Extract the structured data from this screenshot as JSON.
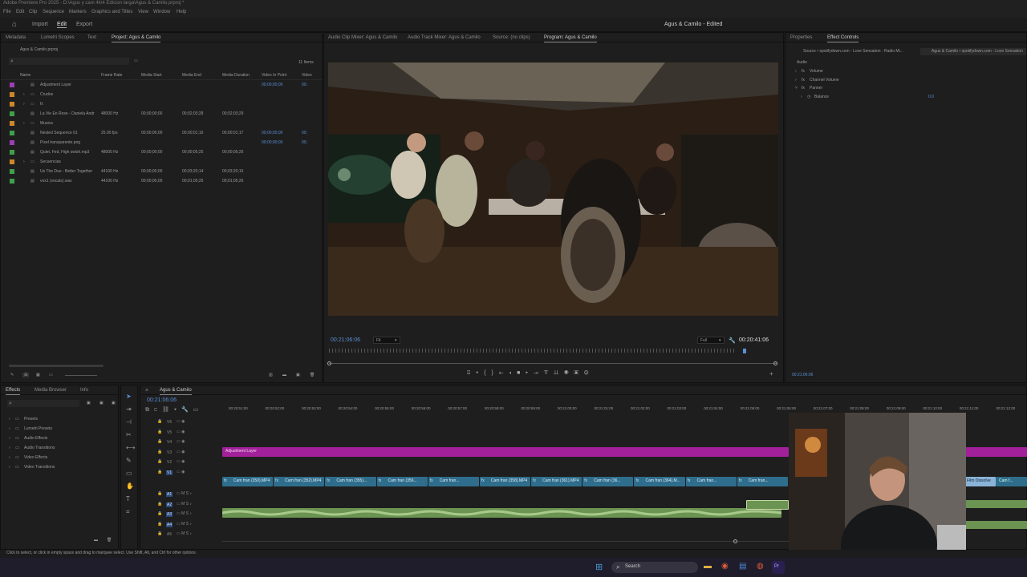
{
  "title_bar": {
    "text": "Adobe Premiere Pro 2025 - D:\\Agus y cam 4k\\4 Edicion larga\\Agus & Camilo.prproj *"
  },
  "menu": [
    "File",
    "Edit",
    "Clip",
    "Sequence",
    "Markers",
    "Graphics and Titles",
    "View",
    "Window",
    "Help"
  ],
  "workspace": {
    "tabs": [
      "Import",
      "Edit",
      "Export"
    ],
    "active": "Edit",
    "project_name": "Agus & Camilo - Edited"
  },
  "project_panel": {
    "tabs": [
      "Metadata",
      "Lumetri Scopes",
      "Text",
      "Project: Agus & Camilo"
    ],
    "active_tab": "Project: Agus & Camilo",
    "file": "Agus & Camilo.prproj",
    "item_count": "11 Items",
    "columns": [
      "Name",
      "Frame Rate",
      "Media Start",
      "Media End",
      "Media Duration",
      "Video In Point",
      "Video"
    ],
    "rows": [
      {
        "name": "Adjustment Layer",
        "fr": "",
        "ms": "",
        "me": "",
        "md": "",
        "vin": "00;00;00;00",
        "v": "00;",
        "color": "#9c3fb6",
        "folder": false
      },
      {
        "name": "Crudos",
        "fr": "",
        "ms": "",
        "me": "",
        "md": "",
        "vin": "",
        "v": "",
        "color": "#d0872a",
        "folder": true
      },
      {
        "name": "fx",
        "fr": "",
        "ms": "",
        "me": "",
        "md": "",
        "vin": "",
        "v": "",
        "color": "#d0872a",
        "folder": true
      },
      {
        "name": "La Vie En Rose - Daniela Andr",
        "fr": "48000 Hz",
        "ms": "00;00;00;00",
        "me": "00;02;03;28",
        "md": "00;02;03;29",
        "vin": "",
        "v": "",
        "color": "#3fa04a",
        "folder": false
      },
      {
        "name": "Musica",
        "fr": "",
        "ms": "",
        "me": "",
        "md": "",
        "vin": "",
        "v": "",
        "color": "#d0872a",
        "folder": true
      },
      {
        "name": "Nested Sequence 01",
        "fr": "25.00 fps",
        "ms": "00;00;00;00",
        "me": "00;00;01;16",
        "md": "00;00;01;17",
        "vin": "00;00;00;00",
        "v": "00;",
        "color": "#3fa04a",
        "folder": false
      },
      {
        "name": "Pixel transparente.png",
        "fr": "",
        "ms": "",
        "me": "",
        "md": "",
        "vin": "00;00;00;00",
        "v": "00;",
        "color": "#9c3fb6",
        "folder": false
      },
      {
        "name": "Quiet, Fed, High swish.mp3",
        "fr": "48000 Hz",
        "ms": "00;00;00;00",
        "me": "00;00;05;25",
        "md": "00;00;05;26",
        "vin": "",
        "v": "",
        "color": "#3fa04a",
        "folder": false
      },
      {
        "name": "Secuencias",
        "fr": "",
        "ms": "",
        "me": "",
        "md": "",
        "vin": "",
        "v": "",
        "color": "#d0872a",
        "folder": true
      },
      {
        "name": "Us The Duo - Better Together",
        "fr": "44100 Hz",
        "ms": "00;00;00;00",
        "me": "00;03;20;14",
        "md": "00;03;20;15",
        "vin": "",
        "v": "",
        "color": "#3fa04a",
        "folder": false
      },
      {
        "name": "vox1 (vocals).wav",
        "fr": "44100 Hz",
        "ms": "00;00;00;00",
        "me": "00;01;05;25",
        "md": "00;01;05;26",
        "vin": "",
        "v": "",
        "color": "#3fa04a",
        "folder": false
      }
    ]
  },
  "program_panel": {
    "tabs": [
      "Audio Clip Mixer: Agus & Camilo",
      "Audio Track Mixer: Agus & Camilo",
      "Source: (no clips)",
      "Program: Agus & Camilo"
    ],
    "active_tab": "Program: Agus & Camilo",
    "timecode": "00:21:06:06",
    "fit": "Fit",
    "quality": "Full",
    "duration": "00:20:41:06"
  },
  "effect_controls": {
    "tabs": [
      "Properties",
      "Effect Controls"
    ],
    "active_tab": "Effect Controls",
    "source": "Source • spotifydown.com - Love Sensation - Radio Mi...",
    "target": "Agus & Camilo • spotifydown.com - Love Sensation",
    "section": "Audio",
    "items": [
      "Volume",
      "Channel Volume",
      "Panner",
      "Balance"
    ],
    "balance_value": "0.0",
    "timecode": "00:21:06:06"
  },
  "effects_panel": {
    "tabs": [
      "Effects",
      "Media Browser",
      "Info"
    ],
    "active_tab": "Effects",
    "items": [
      "Presets",
      "Lumetri Presets",
      "Audio Effects",
      "Audio Transitions",
      "Video Effects",
      "Video Transitions"
    ]
  },
  "timeline": {
    "sequence": "Agus & Camilo",
    "timecode": "00:21:06:06",
    "ruler": [
      "00:20:51:00",
      "00:20:52:00",
      "00:20:53:00",
      "00:20:54:00",
      "00:20:55:00",
      "00:20:56:00",
      "00:20:57:00",
      "00:20:58:00",
      "00:20:59:00",
      "00:21:00:00",
      "00:21:01:00",
      "00:21:02:00",
      "00:21:03:00",
      "00:21:04:00",
      "00:21:05:00",
      "00:21:06:00",
      "00:21:07:00",
      "00:21:08:00",
      "00:21:09:00",
      "00:21:10:00",
      "00:21:11:00",
      "00:21:12:00"
    ],
    "video_tracks": [
      "V6",
      "V5",
      "V4",
      "V3",
      "V2",
      "V1"
    ],
    "audio_tracks": [
      "A1",
      "A2",
      "A3",
      "A4",
      "A5"
    ],
    "adjustment_clip": "Adjustment Layer",
    "v1_clips": [
      "Cam fran (350).MP4",
      "Cam fran (352).MP4",
      "Cam fran (355)...",
      "Cam fran (356...",
      "Cam fran...",
      "Cam fran (358).MP4",
      "Cam fran (361).MP4",
      "Cam fran (36...",
      "Cam fran (364).M...",
      "Cam fran...",
      "Cam fran..."
    ],
    "transition": "Film Dissolve",
    "v1_tail": "Cam f..."
  },
  "status_bar": "Click to select, or click in empty space and drag to marquee select. Use Shift, Alt, and Ctrl for other options.",
  "taskbar": {
    "search": "Search"
  }
}
